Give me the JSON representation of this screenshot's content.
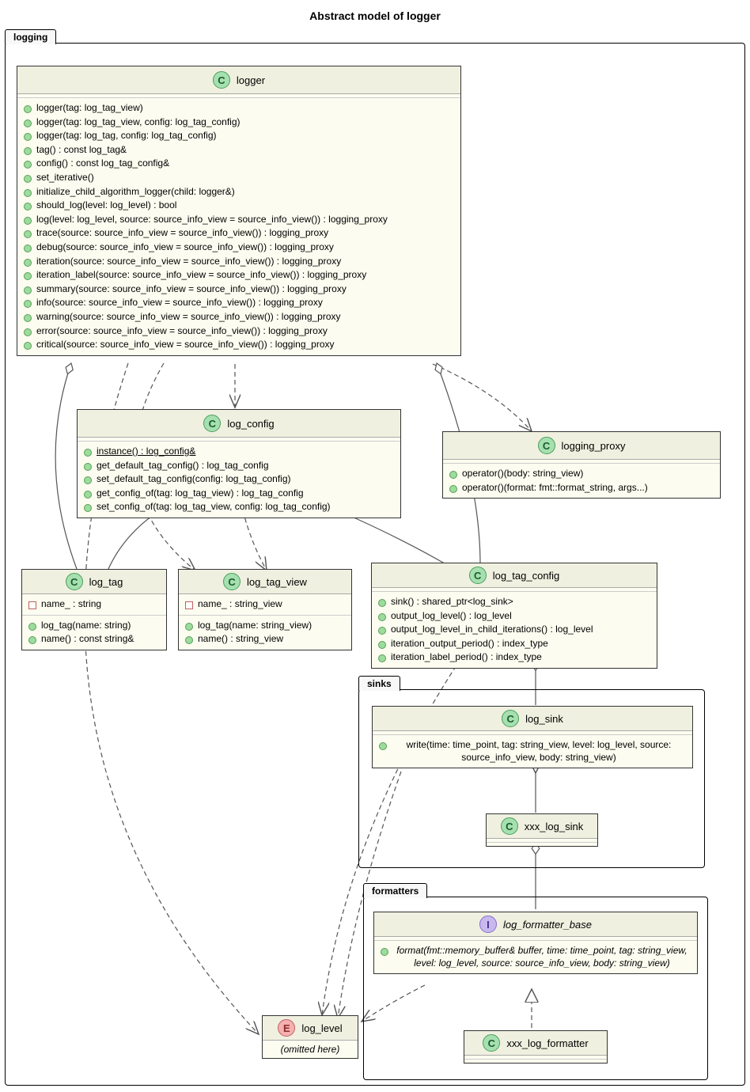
{
  "title": "Abstract model of logger",
  "packages": {
    "logging": {
      "label": "logging"
    },
    "sinks": {
      "label": "sinks"
    },
    "formatters": {
      "label": "formatters"
    }
  },
  "classes": {
    "logger": {
      "name": "logger",
      "kind": "C",
      "members": [
        "logger(tag: log_tag_view)",
        "logger(tag: log_tag_view, config: log_tag_config)",
        "logger(tag: log_tag, config: log_tag_config)",
        "tag() : const log_tag&",
        "config() : const log_tag_config&",
        "set_iterative()",
        "initialize_child_algorithm_logger(child: logger&)",
        "should_log(level: log_level) : bool",
        "log(level: log_level, source: source_info_view = source_info_view()) : logging_proxy",
        "trace(source: source_info_view = source_info_view()) : logging_proxy",
        "debug(source: source_info_view = source_info_view()) : logging_proxy",
        "iteration(source: source_info_view = source_info_view()) : logging_proxy",
        "iteration_label(source: source_info_view = source_info_view()) : logging_proxy",
        "summary(source: source_info_view = source_info_view()) : logging_proxy",
        "info(source: source_info_view = source_info_view()) : logging_proxy",
        "warning(source: source_info_view = source_info_view()) : logging_proxy",
        "error(source: source_info_view = source_info_view()) : logging_proxy",
        "critical(source: source_info_view = source_info_view()) : logging_proxy"
      ]
    },
    "log_config": {
      "name": "log_config",
      "kind": "C",
      "members": [
        {
          "text": "instance() : log_config&",
          "underlined": true
        },
        "get_default_tag_config() : log_tag_config",
        "set_default_tag_config(config: log_tag_config)",
        "get_config_of(tag: log_tag_view) : log_tag_config",
        "set_config_of(tag: log_tag_view, config: log_tag_config)"
      ]
    },
    "logging_proxy": {
      "name": "logging_proxy",
      "kind": "C",
      "members": [
        "operator()(body: string_view)",
        "operator()(format: fmt::format_string, args...)"
      ]
    },
    "log_tag": {
      "name": "log_tag",
      "kind": "C",
      "attributes": [
        {
          "text": "name_ : string",
          "red": true
        }
      ],
      "members": [
        "log_tag(name: string)",
        "name() : const string&"
      ]
    },
    "log_tag_view": {
      "name": "log_tag_view",
      "kind": "C",
      "attributes": [
        {
          "text": "name_ : string_view",
          "red": true
        }
      ],
      "members": [
        "log_tag(name: string_view)",
        "name() : string_view"
      ]
    },
    "log_tag_config": {
      "name": "log_tag_config",
      "kind": "C",
      "members": [
        "sink() : shared_ptr<log_sink>",
        "output_log_level() : log_level",
        "output_log_level_in_child_iterations() : log_level",
        "iteration_output_period() : index_type",
        "iteration_label_period() : index_type"
      ]
    },
    "log_sink": {
      "name": "log_sink",
      "kind": "C",
      "members": [
        "write(time: time_point, tag: string_view, level: log_level, source: source_info_view, body: string_view)"
      ]
    },
    "xxx_log_sink": {
      "name": "xxx_log_sink",
      "kind": "C"
    },
    "log_formatter_base": {
      "name": "log_formatter_base",
      "kind": "I",
      "italic": true,
      "members": [
        {
          "text": "format(fmt::memory_buffer& buffer, time: time_point, tag: string_view, level: log_level, source: source_info_view, body: string_view)",
          "italic": true
        }
      ]
    },
    "xxx_log_formatter": {
      "name": "xxx_log_formatter",
      "kind": "C"
    },
    "log_level": {
      "name": "log_level",
      "kind": "E",
      "note": "(omitted here)"
    }
  }
}
